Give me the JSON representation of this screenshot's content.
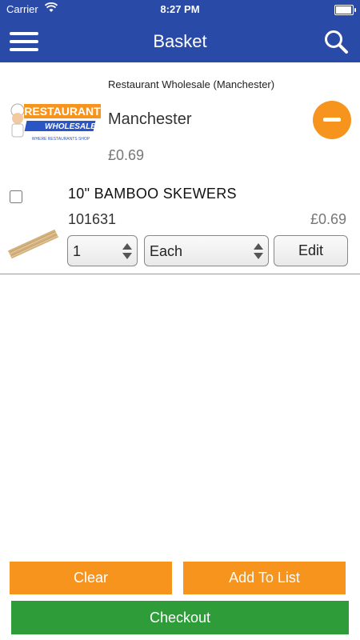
{
  "status_bar": {
    "carrier": "Carrier",
    "time": "8:27 PM"
  },
  "header": {
    "title": "Basket",
    "menu_icon": "hamburger-icon",
    "search_icon": "search-icon"
  },
  "store": {
    "name": "Restaurant Wholesale (Manchester)",
    "city": "Manchester",
    "total": "£0.69",
    "logo": {
      "line1": "RESTAURANT",
      "line2": "WHOLESALE",
      "tagline": "WHERE RESTAURANTS SHOP"
    }
  },
  "items": [
    {
      "name": "10\" BAMBOO SKEWERS",
      "code": "101631",
      "price": "£0.69",
      "quantity": "1",
      "unit": "Each",
      "edit_label": "Edit",
      "checked": false
    }
  ],
  "actions": {
    "clear": "Clear",
    "add_to_list": "Add To List",
    "checkout": "Checkout"
  },
  "colors": {
    "nav": "#2a4aa8",
    "orange": "#f7941e",
    "green": "#2e9c38"
  }
}
